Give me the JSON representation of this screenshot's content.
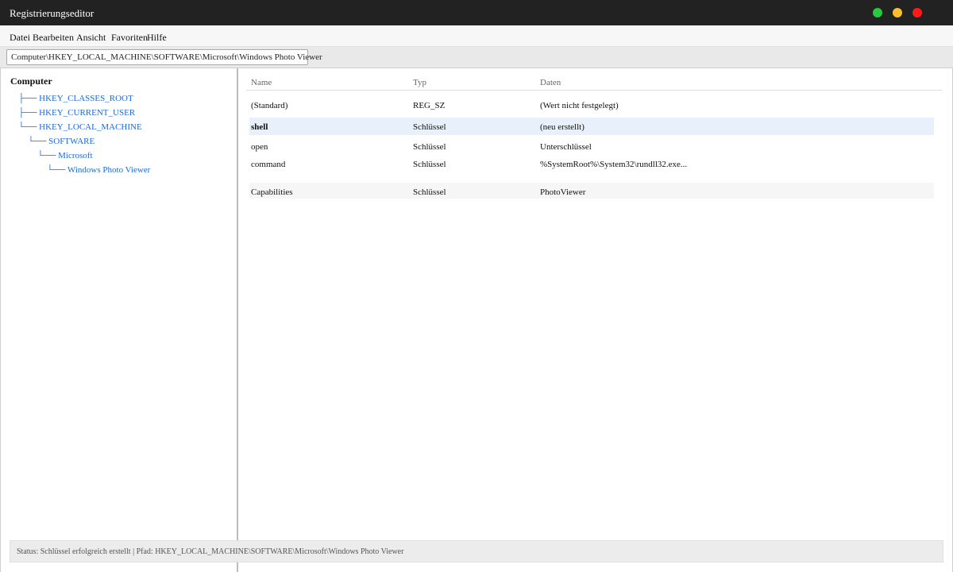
{
  "window": {
    "title": "Registrierungseditor",
    "controls": {
      "green": "#27c93f",
      "yellow": "#ffbd2e",
      "red": "#ff1a1a"
    }
  },
  "menu": {
    "items": [
      "Datei",
      "Bearbeiten",
      "Ansicht",
      "Favoriten",
      "Hilfe"
    ]
  },
  "address": {
    "value": "Computer\\HKEY_LOCAL_MACHINE\\SOFTWARE\\Microsoft\\Windows Photo Viewer"
  },
  "tree": {
    "root": "Computer",
    "items": [
      {
        "label": "├── HKEY_CLASSES_ROOT"
      },
      {
        "label": "├── HKEY_CURRENT_USER"
      },
      {
        "label": "└── HKEY_LOCAL_MACHINE"
      },
      {
        "label": "└── SOFTWARE"
      },
      {
        "label": "└── Microsoft"
      },
      {
        "label": "└── Windows Photo Viewer"
      }
    ]
  },
  "table": {
    "headers": {
      "name": "Name",
      "type": "Typ",
      "data": "Daten"
    },
    "rows": [
      {
        "name": "(Standard)",
        "type": "REG_SZ",
        "data": "(Wert nicht festgelegt)"
      },
      {
        "name": "shell",
        "type": "Schlüssel",
        "data": "(neu erstellt)"
      },
      {
        "name": "open",
        "type": "Schlüssel",
        "data": "Unterschlüssel"
      },
      {
        "name": "command",
        "type": "Schlüssel",
        "data": "%SystemRoot%\\System32\\rundll32.exe..."
      },
      {
        "name": "Capabilities",
        "type": "Schlüssel",
        "data": "PhotoViewer"
      }
    ]
  },
  "status": {
    "text": "Status: Schlüssel erfolgreich erstellt | Pfad: HKEY_LOCAL_MACHINE\\SOFTWARE\\Microsoft\\Windows Photo Viewer"
  },
  "colors": {
    "titlebar": "#222222",
    "tree_link": "#1a6ad8",
    "selected_row": "#e8f0fb"
  }
}
